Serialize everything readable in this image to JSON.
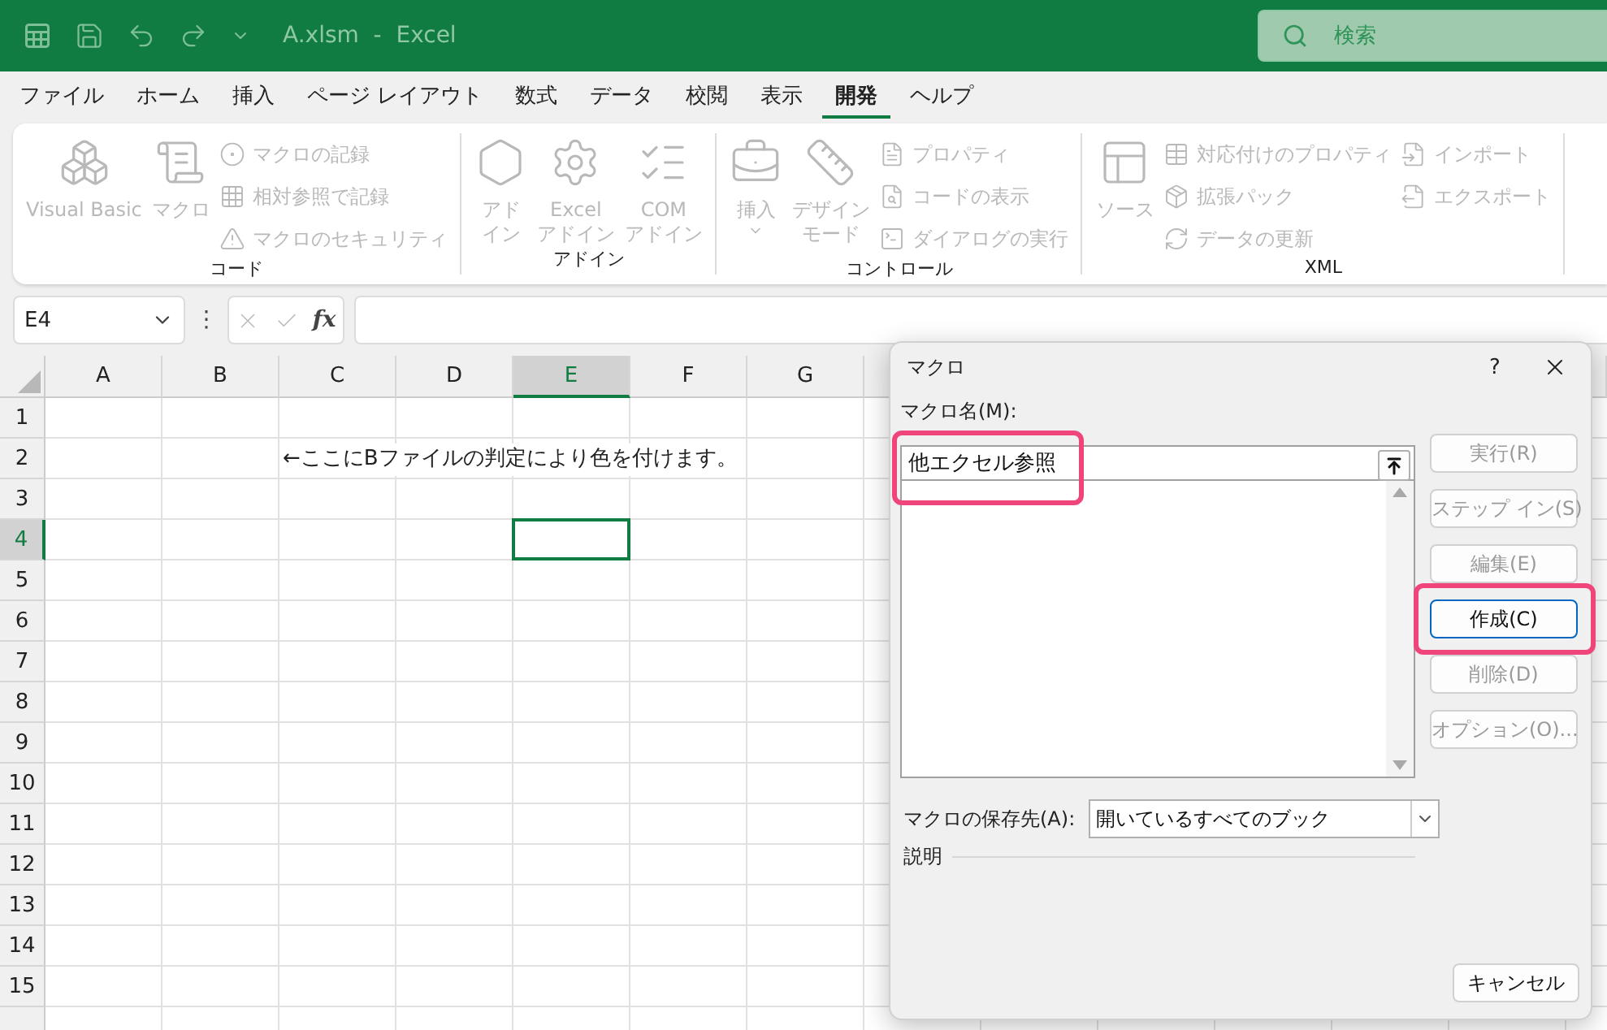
{
  "title_bar": {
    "title": "A.xlsm  -  Excel",
    "search_placeholder": "検索"
  },
  "menu_tabs": [
    {
      "label": "ファイル",
      "selected": false
    },
    {
      "label": "ホーム",
      "selected": false
    },
    {
      "label": "挿入",
      "selected": false
    },
    {
      "label": "ページ レイアウト",
      "selected": false
    },
    {
      "label": "数式",
      "selected": false
    },
    {
      "label": "データ",
      "selected": false
    },
    {
      "label": "校閲",
      "selected": false
    },
    {
      "label": "表示",
      "selected": false
    },
    {
      "label": "開発",
      "selected": true
    },
    {
      "label": "ヘルプ",
      "selected": false
    }
  ],
  "ribbon": {
    "groups": [
      {
        "label": "コード",
        "items": [
          {
            "kind": "large",
            "lines": [
              "Visual Basic"
            ],
            "disabled": true
          },
          {
            "kind": "large",
            "lines": [
              "マクロ"
            ],
            "disabled": true
          },
          {
            "kind": "stack",
            "items": [
              {
                "label": "マクロの記録",
                "disabled": true
              },
              {
                "label": "相対参照で記録",
                "disabled": true
              },
              {
                "label": "マクロのセキュリティ",
                "disabled": true
              }
            ]
          }
        ]
      },
      {
        "label": "アドイン",
        "items": [
          {
            "kind": "large",
            "lines": [
              "アド",
              "イン"
            ],
            "disabled": true
          },
          {
            "kind": "large",
            "lines": [
              "Excel",
              "アドイン"
            ],
            "disabled": true
          },
          {
            "kind": "large",
            "lines": [
              "COM",
              "アドイン"
            ],
            "disabled": true
          }
        ]
      },
      {
        "label": "コントロール",
        "items": [
          {
            "kind": "large",
            "lines": [
              "挿入"
            ],
            "dropdown": true,
            "disabled": true
          },
          {
            "kind": "large",
            "lines": [
              "デザイン",
              "モード"
            ],
            "disabled": true
          },
          {
            "kind": "stack",
            "items": [
              {
                "label": "プロパティ",
                "disabled": true
              },
              {
                "label": "コードの表示",
                "disabled": true
              },
              {
                "label": "ダイアログの実行",
                "disabled": true
              }
            ]
          }
        ]
      },
      {
        "label": "XML",
        "items": [
          {
            "kind": "large",
            "lines": [
              "ソース"
            ],
            "disabled": true
          },
          {
            "kind": "stack",
            "items": [
              {
                "label": "対応付けのプロパティ",
                "disabled": true
              },
              {
                "label": "拡張パック",
                "disabled": true
              },
              {
                "label": "データの更新",
                "disabled": true
              }
            ]
          },
          {
            "kind": "stack",
            "items": [
              {
                "label": "インポート",
                "disabled": true
              },
              {
                "label": "エクスポート",
                "disabled": true
              }
            ]
          }
        ]
      }
    ]
  },
  "formula_bar": {
    "name_box": "E4",
    "more": "⋮",
    "fx": "fx"
  },
  "sheet": {
    "columns": [
      {
        "label": "A",
        "selected": false
      },
      {
        "label": "B",
        "selected": false
      },
      {
        "label": "C",
        "selected": false
      },
      {
        "label": "D",
        "selected": false
      },
      {
        "label": "E",
        "selected": true
      },
      {
        "label": "F",
        "selected": false
      },
      {
        "label": "G",
        "selected": false
      }
    ],
    "rows": [
      {
        "label": "1",
        "selected": false
      },
      {
        "label": "2",
        "selected": false,
        "cells": [
          {
            "kind": "blank"
          },
          {
            "kind": "blank"
          },
          {
            "kind": "text",
            "text": "←ここにBファイルの判定により色を付けます。"
          }
        ]
      },
      {
        "label": "3",
        "selected": false
      },
      {
        "label": "4",
        "selected": true,
        "cells": [
          {
            "kind": "blank"
          },
          {
            "kind": "blank"
          },
          {
            "kind": "blank"
          },
          {
            "kind": "blank"
          },
          {
            "kind": "active"
          }
        ]
      },
      {
        "label": "5",
        "selected": false
      },
      {
        "label": "6",
        "selected": false
      },
      {
        "label": "7",
        "selected": false
      },
      {
        "label": "8",
        "selected": false
      },
      {
        "label": "9",
        "selected": false
      },
      {
        "label": "10",
        "selected": false
      },
      {
        "label": "11",
        "selected": false
      },
      {
        "label": "12",
        "selected": false
      },
      {
        "label": "13",
        "selected": false
      },
      {
        "label": "14",
        "selected": false
      },
      {
        "label": "15",
        "selected": false
      }
    ]
  },
  "dialog": {
    "title": "マクロ",
    "help": "?",
    "name_label": "マクロ名(M):",
    "name_value": "他エクセル参照",
    "name_highlighted": true,
    "buttons": [
      {
        "label": "実行(R)",
        "disabled": true,
        "focused": false,
        "highlighted": false
      },
      {
        "label": "ステップ イン(S)",
        "disabled": true,
        "focused": false,
        "highlighted": false
      },
      {
        "label": "編集(E)",
        "disabled": true,
        "focused": false,
        "highlighted": false
      },
      {
        "label": "作成(C)",
        "disabled": false,
        "focused": true,
        "highlighted": true
      },
      {
        "label": "削除(D)",
        "disabled": true,
        "focused": false,
        "highlighted": false
      },
      {
        "label": "オプション(O)...",
        "disabled": true,
        "focused": false,
        "highlighted": false
      }
    ],
    "location_label": "マクロの保存先(A):",
    "location_value": "開いているすべてのブック",
    "description_label": "説明",
    "cancel": "キャンセル"
  }
}
